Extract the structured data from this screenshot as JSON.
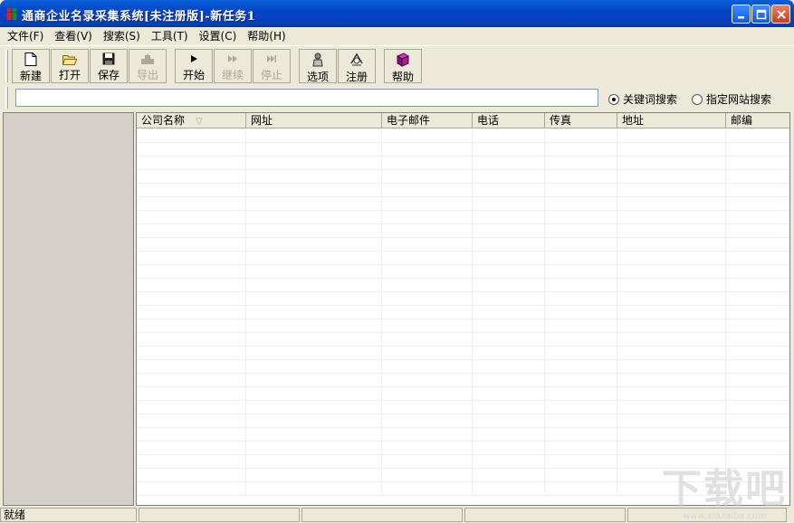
{
  "window": {
    "title": "通商企业名录采集系统[未注册版]-新任务1",
    "buttons": {
      "minimize": "_",
      "maximize": "□",
      "close": "×"
    }
  },
  "menu": [
    {
      "label": "文件(F)",
      "icon": ""
    },
    {
      "label": "查看(V)"
    },
    {
      "label": "搜索(S)"
    },
    {
      "label": "工具(T)"
    },
    {
      "label": "设置(C)"
    },
    {
      "label": "帮助(H)"
    }
  ],
  "toolbar": [
    {
      "label": "新建",
      "icon": "new-document-icon",
      "enabled": true
    },
    {
      "label": "打开",
      "icon": "open-folder-icon",
      "enabled": true
    },
    {
      "label": "保存",
      "icon": "save-disk-icon",
      "enabled": true
    },
    {
      "label": "导出",
      "icon": "export-icon",
      "enabled": false
    },
    {
      "label": "开始",
      "icon": "play-icon",
      "enabled": true
    },
    {
      "label": "继续",
      "icon": "fast-forward-icon",
      "enabled": false
    },
    {
      "label": "停止",
      "icon": "skip-end-icon",
      "enabled": false
    },
    {
      "label": "选项",
      "icon": "options-icon",
      "enabled": true
    },
    {
      "label": "注册",
      "icon": "register-icon",
      "enabled": true
    },
    {
      "label": "帮助",
      "icon": "help-book-icon",
      "enabled": true
    }
  ],
  "search": {
    "value": "",
    "mode_keyword": "关键词搜索",
    "mode_site": "指定网站搜索",
    "selected": "关键词搜索"
  },
  "table": {
    "columns": [
      "公司名称",
      "网址",
      "电子邮件",
      "电话",
      "传真",
      "地址",
      "邮编"
    ],
    "sort_indicator": "▽",
    "rows": []
  },
  "status": {
    "text": "就绪"
  },
  "watermark": {
    "text": "下载吧",
    "sub": "www.xiazaiba.com"
  },
  "colors": {
    "title_bar": "#0246c8",
    "chrome": "#ece9d8",
    "sidebar": "#d4d0c8"
  }
}
